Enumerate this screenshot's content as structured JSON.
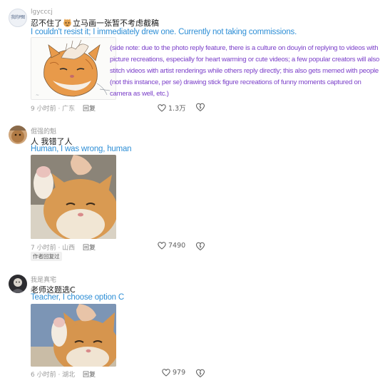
{
  "comments": [
    {
      "username": "lgycccj",
      "text_before_emoji": "忍不住了",
      "text_after_emoji": "立马画一张暂不考虑截稿",
      "translation": "I couldn't resist it; I immediately drew one. Currently not taking commissions.",
      "meta": "9 小时前 · 广东",
      "reply_label": "回复",
      "likes": "1.3万",
      "avatar_text": "我的P图"
    },
    {
      "username": "倔强的魁",
      "text": "人 我错了人",
      "translation": "Human, I was wrong, human",
      "meta": "7 小时前 · 山西",
      "reply_label": "回复",
      "likes": "7490",
      "badge": "作者回复过"
    },
    {
      "username": "我是真宅",
      "text": "老师这题选C",
      "translation": "Teacher, I choose option C",
      "meta": "6 小时前 · 湖北",
      "reply_label": "回复",
      "likes": "979"
    }
  ],
  "side_note": "(side note: due to the photo reply feature, there is a culture on douyin of replying to videos with picture recreations, especially for heart warming or cute videos; a few popular creators will also stitch videos with artist renderings while others reply directly; this also gets memed with people (not this instance, per se) drawing stick figure recreations of funny moments captured on camera as well, etc.)",
  "colors": {
    "translation": "#2f8fd6",
    "side_note": "#7b3fc9",
    "meta": "#9a9a9a"
  },
  "icons": [
    "heart-icon",
    "dislike-icon",
    "cat-emoji-icon"
  ]
}
